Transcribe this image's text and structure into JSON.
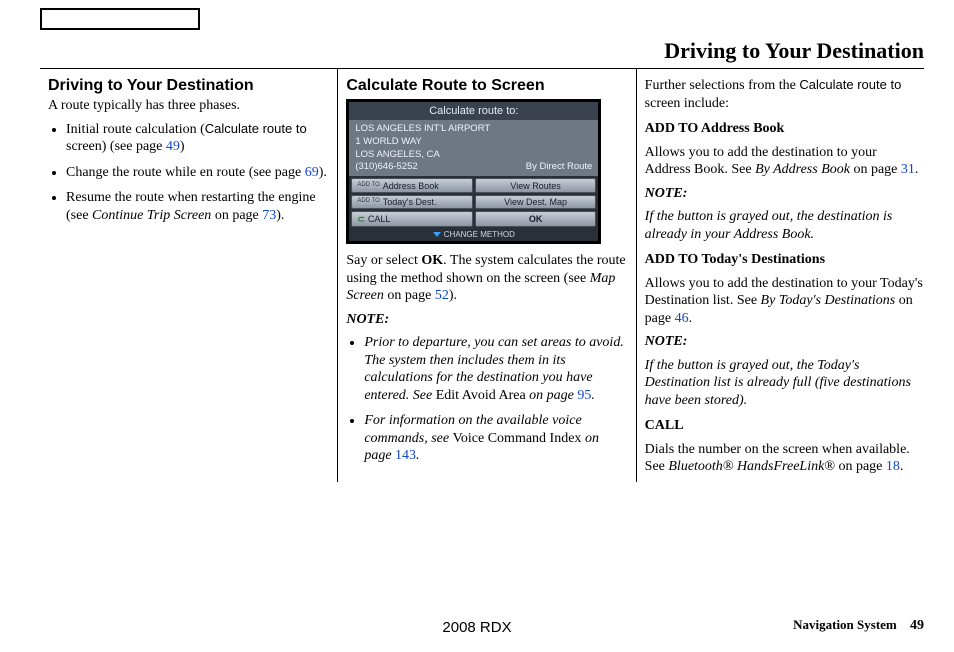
{
  "pageTitle": "Driving to Your Destination",
  "col1": {
    "heading": "Driving to Your Destination",
    "intro": "A route typically has three phases.",
    "b1a": "Initial route calculation (",
    "b1sans": "Calculate route to",
    "b1b": " screen) (see page ",
    "b1pg": "49",
    "b1c": ")",
    "b2a": "Change the route while en route (see page ",
    "b2pg": "69",
    "b2b": ").",
    "b3a": "Resume the route when restarting the engine (see ",
    "b3i": "Continue Trip Screen",
    "b3b": " on page ",
    "b3pg": "73",
    "b3c": ")."
  },
  "col2": {
    "heading": "Calculate Route to Screen",
    "scr": {
      "title": "Calculate route to:",
      "l1": "LOS ANGELES INT'L AIRPORT",
      "l2": "1 WORLD WAY",
      "l3": "LOS ANGELES, CA",
      "l4": "(310)646-5252",
      "route": "By Direct Route",
      "btn1": "Address Book",
      "btn2": "View Routes",
      "btn3": "Today's Dest.",
      "btn4": "View Dest. Map",
      "btn5": "CALL",
      "btn6": "OK",
      "prefix": "ADD\nTO",
      "foot": "CHANGE METHOD"
    },
    "p1a": "Say or select ",
    "p1b": "OK",
    "p1c": ". The system calculates the route using the method shown on the screen (see ",
    "p1i": "Map Screen",
    "p1d": " on page ",
    "p1pg": "52",
    "p1e": ").",
    "noteHead": "NOTE:",
    "n1a": "Prior to departure, you can set areas to avoid. The system then includes them in its calculations for the destination you have entered. See ",
    "n1r": "Edit Avoid Area",
    "n1b": " on page ",
    "n1pg": "95",
    "n1c": ".",
    "n2a": "For information on the available voice commands, see ",
    "n2r": "Voice Command Index",
    "n2b": " on page ",
    "n2pg": "143",
    "n2c": "."
  },
  "col3": {
    "p1a": "Further selections from the ",
    "p1sans": "Calculate route to",
    "p1b": " screen include:",
    "h1": "ADD TO Address Book",
    "t1a": "Allows you to add the destination to your Address Book. See ",
    "t1i": "By Address Book",
    "t1b": " on page ",
    "t1pg": "31",
    "t1c": ".",
    "noteHead": "NOTE:",
    "note1": "If the button is grayed out, the destination is already in your Address Book.",
    "h2": "ADD TO Today's Destinations",
    "t2a": "Allows you to add the destination to your Today's Destination list. See ",
    "t2i": "By Today's Destinations",
    "t2b": " on page ",
    "t2pg": "46",
    "t2c": ".",
    "note2": "If the button is grayed out, the Today's Destination list is already full (five destinations have been stored).",
    "h3": "CALL",
    "t3a": "Dials the number on the screen when available. See ",
    "t3i": "Bluetooth® HandsFreeLink®",
    "t3b": " on page ",
    "t3pg": "18",
    "t3c": "."
  },
  "footer": {
    "center": "2008  RDX",
    "label": "Navigation System",
    "page": "49"
  }
}
